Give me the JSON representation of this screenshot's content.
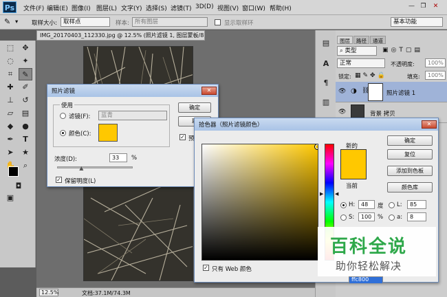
{
  "app": {
    "logo": "Ps"
  },
  "menu": [
    "文件(F)",
    "编辑(E)",
    "图像(I)",
    "图层(L)",
    "文字(Y)",
    "选择(S)",
    "滤镜(T)",
    "3D(D)",
    "视图(V)",
    "窗口(W)",
    "帮助(H)"
  ],
  "options": {
    "sample_size_label": "取样大小:",
    "sample_size_value": "取样点",
    "sample_label": "样本:",
    "sample_value": "所有图层",
    "show_ring_label": "显示取样环",
    "workspace": "基本功能"
  },
  "document": {
    "tab_title": "IMG_20170403_112330.jpg @ 12.5% (照片滤镜 1, 图层蒙板/8) *",
    "zoom": "12.5%",
    "doc_info": "文档:37.1M/74.3M"
  },
  "layers_panel": {
    "tabs": [
      "图层",
      "路径",
      "通道"
    ],
    "kind_filter": "类型",
    "blend_mode": "正常",
    "opacity_label": "不透明度:",
    "opacity_value": "100%",
    "lock_label": "锁定:",
    "fill_label": "填充:",
    "fill_value": "100%",
    "layers": [
      {
        "name": "照片滤镜 1"
      },
      {
        "name": "背景 拷贝"
      }
    ]
  },
  "photo_filter_dialog": {
    "title": "照片滤镜",
    "group_label": "使用",
    "filter_label": "滤镜(F):",
    "filter_value": "蓝青",
    "color_label": "颜色(C):",
    "density_label": "浓度(D):",
    "density_value": "33",
    "density_unit": "%",
    "density_percent": 33,
    "preserve_label": "保留明度(L)",
    "ok_label": "确定",
    "cancel_label": "取",
    "preview_label": "预",
    "swatch_color": "#ffc800"
  },
  "color_picker_dialog": {
    "title": "拾色器（照片滤镜颜色）",
    "new_label": "新的",
    "current_label": "当前",
    "new_color": "#ffc800",
    "current_color": "#ffc800",
    "ok_label": "确定",
    "reset_label": "复位",
    "add_swatch_label": "添加到色板",
    "libraries_label": "颜色库",
    "h_label": "H:",
    "h_value": "48",
    "h_unit": "度",
    "s_label": "S:",
    "s_value": "100",
    "s_unit": "%",
    "l_label": "L:",
    "l_value": "85",
    "a_label": "a:",
    "a_value": "8",
    "web_only_label": "只有 Web 颜色",
    "hex_value": "ffc800"
  },
  "watermark": {
    "title": "百科全说",
    "subtitle": "助你轻松解决"
  }
}
